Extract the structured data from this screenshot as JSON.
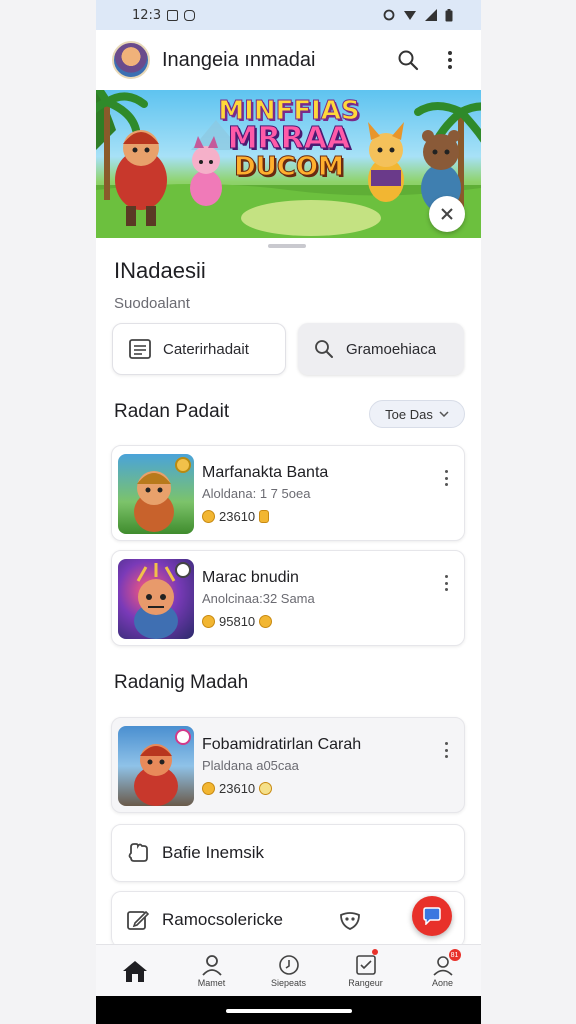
{
  "status_bar": {
    "time": "12:3"
  },
  "app_bar": {
    "title": "Inangeia ınmadai"
  },
  "banner": {
    "logo_lines": [
      "MINFFIAS",
      "MRRAA",
      "DUCOM"
    ]
  },
  "section1": {
    "title": "INadaesii",
    "subtitle": "Suodoalant",
    "button_left_label": "Caterirhadait",
    "button_right_label": "Gramoehiaca"
  },
  "recent": {
    "title": "Radan Padait",
    "filter_label": "Toe Das"
  },
  "games": [
    {
      "name": "Marfanakta Banta",
      "sub": "Aloldana: 1 7 5oea",
      "stat": "23610"
    },
    {
      "name": "Marac bnudin",
      "sub": "Anolcinaa:32 Sama",
      "stat": "95810"
    }
  ],
  "section2": {
    "title": "Radanig Madah"
  },
  "games2": [
    {
      "name": "Fobamidratirlan Carah",
      "sub": "Plaldana a05caa",
      "stat": "23610"
    }
  ],
  "rows": [
    {
      "label": "Bafie Inemsik"
    },
    {
      "label": "Ramocsolericke"
    }
  ],
  "nav": [
    {
      "label": "Home"
    },
    {
      "label": "Mamet"
    },
    {
      "label": "Siepeats"
    },
    {
      "label": "Rangeur"
    },
    {
      "label": "Aone",
      "badge": "81"
    }
  ],
  "colors": {
    "accent_red": "#e8312a",
    "status_bar_bg": "#dde8f7"
  }
}
